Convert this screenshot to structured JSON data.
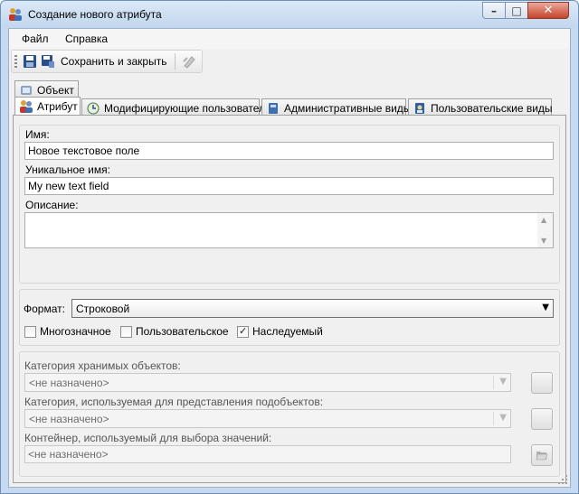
{
  "window": {
    "title": "Создание нового атрибута",
    "icon": "users-icon",
    "controls": {
      "minimize": "–",
      "maximize": "□",
      "close": "✕"
    }
  },
  "menu": {
    "items": [
      "Файл",
      "Справка"
    ]
  },
  "toolbar": {
    "save_icon": "save-icon",
    "save_close_icon": "save-close-icon",
    "save_close_label": "Сохранить и закрыть",
    "disabled_action_icon": "edit-icon"
  },
  "tabs": {
    "top": [
      {
        "label": "Объект",
        "icon": "object-icon"
      }
    ],
    "bottom": [
      {
        "label": "Атрибут",
        "icon": "users-icon",
        "active": true
      },
      {
        "label": "Модифицирующие пользователи",
        "icon": "clock-refresh-icon",
        "active": false
      },
      {
        "label": "Административные виды",
        "icon": "book-icon",
        "active": false
      },
      {
        "label": "Пользовательские виды",
        "icon": "user-book-icon",
        "active": false
      }
    ]
  },
  "general": {
    "name_label": "Имя:",
    "name_value": "Новое текстовое поле",
    "unique_name_label": "Уникальное имя:",
    "unique_name_value": "My new text field",
    "description_label": "Описание:",
    "description_value": ""
  },
  "format": {
    "label": "Формат:",
    "value": "Строковой",
    "checkboxes": [
      {
        "label": "Многозначное",
        "checked": false
      },
      {
        "label": "Пользовательское",
        "checked": false
      },
      {
        "label": "Наследуемый",
        "checked": true
      }
    ]
  },
  "categories": {
    "stored_objects_label": "Категория хранимых объектов:",
    "stored_objects_value": "<не назначено>",
    "subobjects_label": "Категория, используемая для представления подобъектов:",
    "subobjects_value": "<не назначено>",
    "container_label": "Контейнер, используемый для выбора значений:",
    "container_value": "<не назначено>",
    "folder_icon": "folder-open-icon"
  },
  "colors": {
    "titlebar": "#c2d6ee",
    "close_button": "#c7432b",
    "panel": "#f0f0f0",
    "disabled_text": "#6d6d6d"
  }
}
